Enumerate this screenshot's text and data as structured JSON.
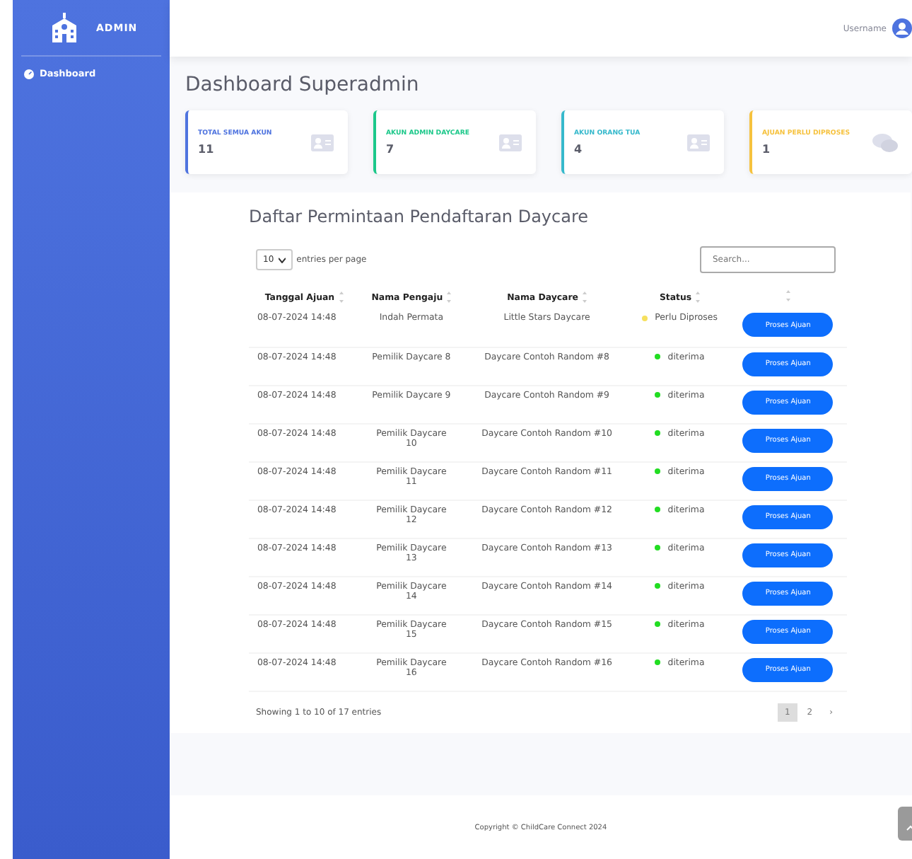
{
  "sidebar": {
    "brand": "ADMIN",
    "items": [
      {
        "label": "Dashboard",
        "selected": true
      }
    ]
  },
  "topbar": {
    "username": "Username"
  },
  "page_title": "Dashboard Superadmin",
  "cards": [
    {
      "label": "TOTAL SEMUA AKUN",
      "value": "11",
      "color": "#4e73df",
      "kind": "account"
    },
    {
      "label": "AKUN ADMIN DAYCARE",
      "value": "7",
      "color": "#1cc88a",
      "kind": "account"
    },
    {
      "label": "AKUN ORANG TUA",
      "value": "4",
      "color": "#36b9cc",
      "kind": "account"
    },
    {
      "label": "AJUAN PERLU DIPROSES",
      "value": "1",
      "color": "#f6c23e",
      "kind": "pending"
    }
  ],
  "table": {
    "title": "Daftar Permintaan Pendaftaran Daycare",
    "page_size": "10",
    "page_size_label": "entries per page",
    "search_placeholder": "Search...",
    "columns": [
      "Tanggal Ajuan",
      "Nama Pengaju",
      "Nama Daycare",
      "Status",
      ""
    ],
    "rows": [
      {
        "date": "08-07-2024 14:48",
        "applicant": "Indah Permata",
        "daycare": "Little Stars Daycare",
        "status": "Perlu Diproses",
        "color": "#f6e05e",
        "action": "Proses Ajuan"
      },
      {
        "date": "08-07-2024 14:48",
        "applicant": "Pemilik Daycare 8",
        "daycare": "Daycare Contoh Random #8",
        "status": "diterima",
        "color": "#22dd22",
        "action": "Proses Ajuan"
      },
      {
        "date": "08-07-2024 14:48",
        "applicant": "Pemilik Daycare 9",
        "daycare": "Daycare Contoh Random #9",
        "status": "diterima",
        "color": "#22dd22",
        "action": "Proses Ajuan"
      },
      {
        "date": "08-07-2024 14:48",
        "applicant": "Pemilik Daycare 10",
        "daycare": "Daycare Contoh Random #10",
        "status": "diterima",
        "color": "#22dd22",
        "action": "Proses Ajuan"
      },
      {
        "date": "08-07-2024 14:48",
        "applicant": "Pemilik Daycare 11",
        "daycare": "Daycare Contoh Random #11",
        "status": "diterima",
        "color": "#22dd22",
        "action": "Proses Ajuan"
      },
      {
        "date": "08-07-2024 14:48",
        "applicant": "Pemilik Daycare 12",
        "daycare": "Daycare Contoh Random #12",
        "status": "diterima",
        "color": "#22dd22",
        "action": "Proses Ajuan"
      },
      {
        "date": "08-07-2024 14:48",
        "applicant": "Pemilik Daycare 13",
        "daycare": "Daycare Contoh Random #13",
        "status": "diterima",
        "color": "#22dd22",
        "action": "Proses Ajuan"
      },
      {
        "date": "08-07-2024 14:48",
        "applicant": "Pemilik Daycare 14",
        "daycare": "Daycare Contoh Random #14",
        "status": "diterima",
        "color": "#22dd22",
        "action": "Proses Ajuan"
      },
      {
        "date": "08-07-2024 14:48",
        "applicant": "Pemilik Daycare 15",
        "daycare": "Daycare Contoh Random #15",
        "status": "diterima",
        "color": "#22dd22",
        "action": "Proses Ajuan"
      },
      {
        "date": "08-07-2024 14:48",
        "applicant": "Pemilik Daycare 16",
        "daycare": "Daycare Contoh Random #16",
        "status": "diterima",
        "color": "#22dd22",
        "action": "Proses Ajuan"
      }
    ],
    "info": "Showing 1 to 10 of 17 entries",
    "pages": [
      {
        "label": "1",
        "selected": true
      },
      {
        "label": "2",
        "selected": false
      },
      {
        "label": "›",
        "selected": false
      }
    ]
  },
  "footer": "Copyright © ChildCare Connect 2024"
}
